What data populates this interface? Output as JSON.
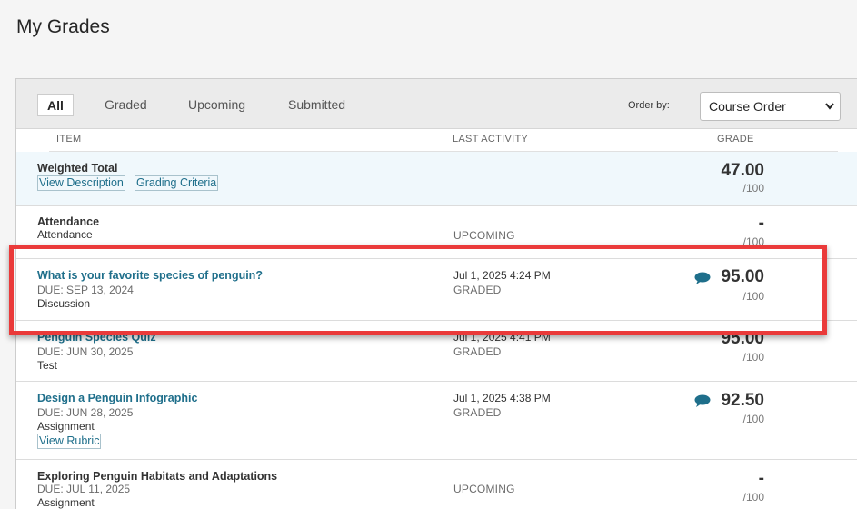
{
  "page_title": "My Grades",
  "filters": {
    "tabs": [
      {
        "label": "All",
        "active": true
      },
      {
        "label": "Graded",
        "active": false
      },
      {
        "label": "Upcoming",
        "active": false
      },
      {
        "label": "Submitted",
        "active": false
      }
    ],
    "order_label": "Order by:",
    "order_value": "Course Order"
  },
  "columns": {
    "item": "ITEM",
    "last_activity": "LAST ACTIVITY",
    "grade": "GRADE"
  },
  "rows": [
    {
      "title": "Weighted Total",
      "links": [
        "View Description",
        "Grading Criteria"
      ],
      "grade": "47.00",
      "out_of": "/100"
    },
    {
      "title": "Attendance",
      "subtitle": "Attendance",
      "status": "UPCOMING",
      "grade": "-",
      "out_of": "/100"
    },
    {
      "title": "What is your favorite species of penguin?",
      "due": "DUE: SEP 13, 2024",
      "type": "Discussion",
      "date": "Jul 1, 2025 4:24 PM",
      "status": "GRADED",
      "grade": "95.00",
      "out_of": "/100",
      "has_comment": true
    },
    {
      "title": "Penguin Species Quiz",
      "due": "DUE: JUN 30, 2025",
      "type": "Test",
      "date": "Jul 1, 2025 4:41 PM",
      "status": "GRADED",
      "grade": "95.00",
      "out_of": "/100"
    },
    {
      "title": "Design a Penguin Infographic",
      "due": "DUE: JUN 28, 2025",
      "type": "Assignment",
      "link": "View Rubric",
      "date": "Jul 1, 2025 4:38 PM",
      "status": "GRADED",
      "grade": "92.50",
      "out_of": "/100",
      "has_comment": true
    },
    {
      "title": "Exploring Penguin Habitats and Adaptations",
      "due": "DUE: JUL 11, 2025",
      "type": "Assignment",
      "status": "UPCOMING",
      "grade": "-",
      "out_of": "/100"
    }
  ],
  "colors": {
    "link": "#1f6f8b",
    "highlight": "#ea3a3a",
    "weighted_bg": "#f0f8fc"
  },
  "icons": {
    "comment": "speech-bubble-icon",
    "dropdown": "chevron-down-icon"
  }
}
